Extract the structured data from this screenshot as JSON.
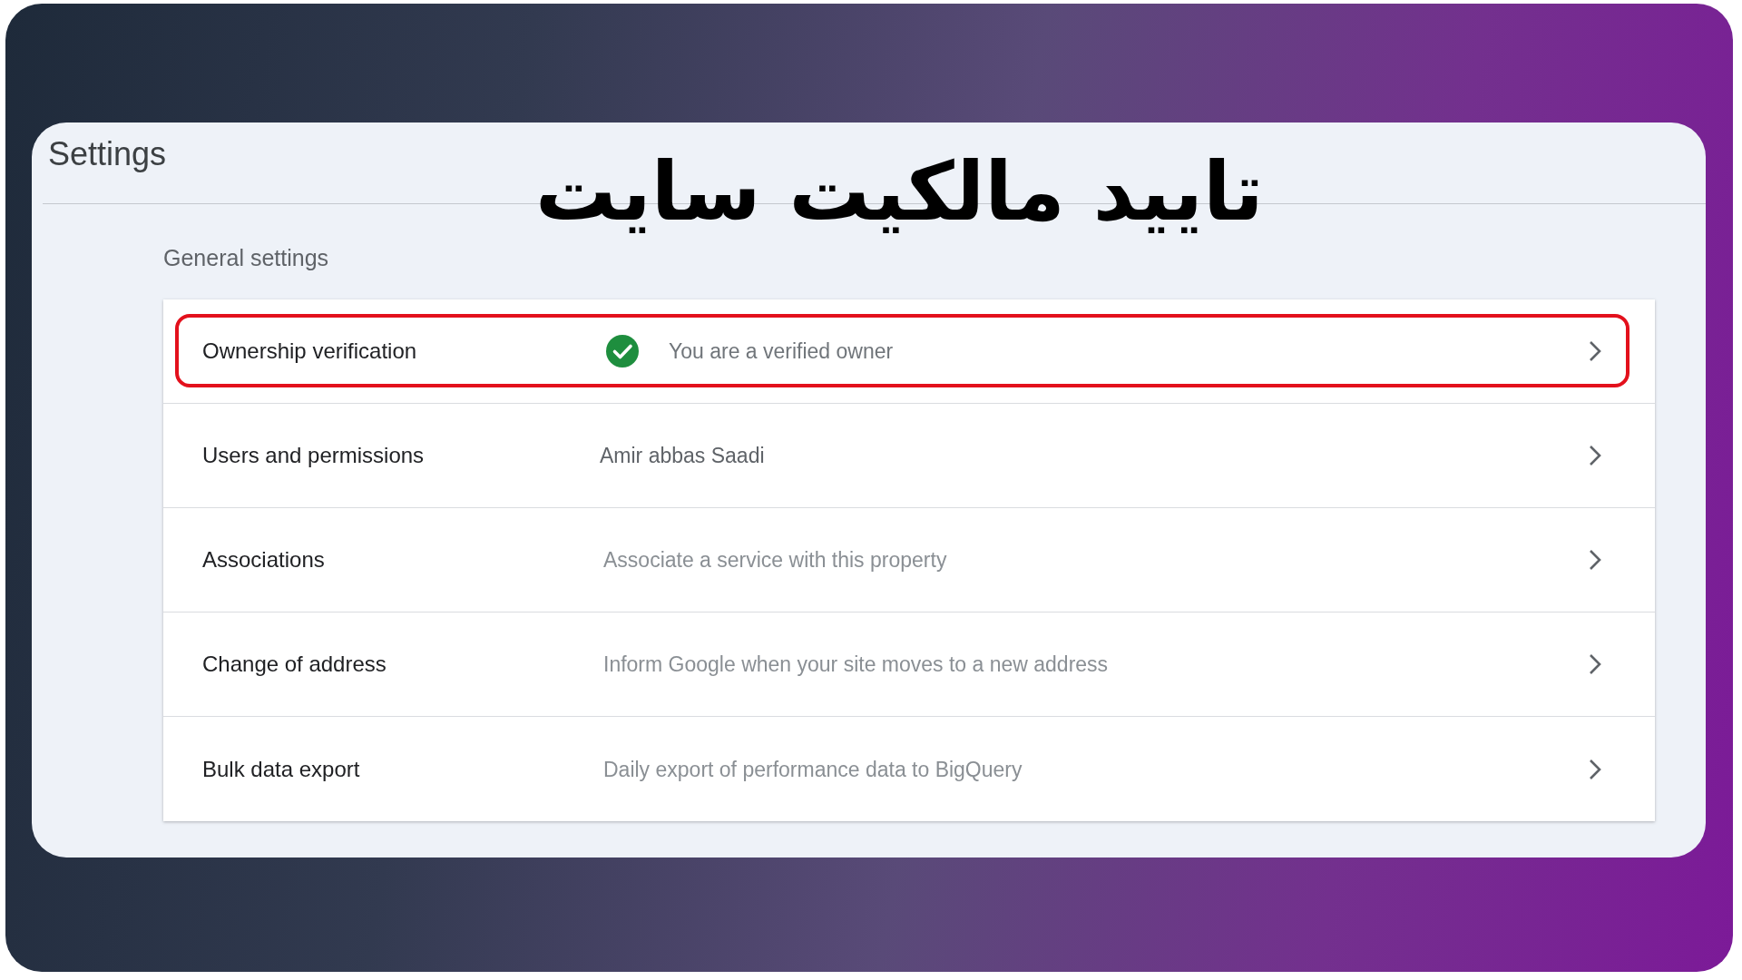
{
  "overlay_title": "تایید مالکیت سایت",
  "page": {
    "title": "Settings",
    "section": "General settings",
    "rows": [
      {
        "label": "Ownership verification",
        "kind": "status",
        "value": "You are a verified owner",
        "highlighted": true
      },
      {
        "label": "Users and permissions",
        "kind": "value",
        "value": "Amir abbas Saadi",
        "highlighted": false
      },
      {
        "label": "Associations",
        "kind": "description",
        "value": "Associate a service with this property",
        "highlighted": false
      },
      {
        "label": "Change of address",
        "kind": "description",
        "value": "Inform Google when your site moves to a new address",
        "highlighted": false
      },
      {
        "label": "Bulk data export",
        "kind": "description",
        "value": "Daily export of performance data to BigQuery",
        "highlighted": false
      }
    ]
  }
}
